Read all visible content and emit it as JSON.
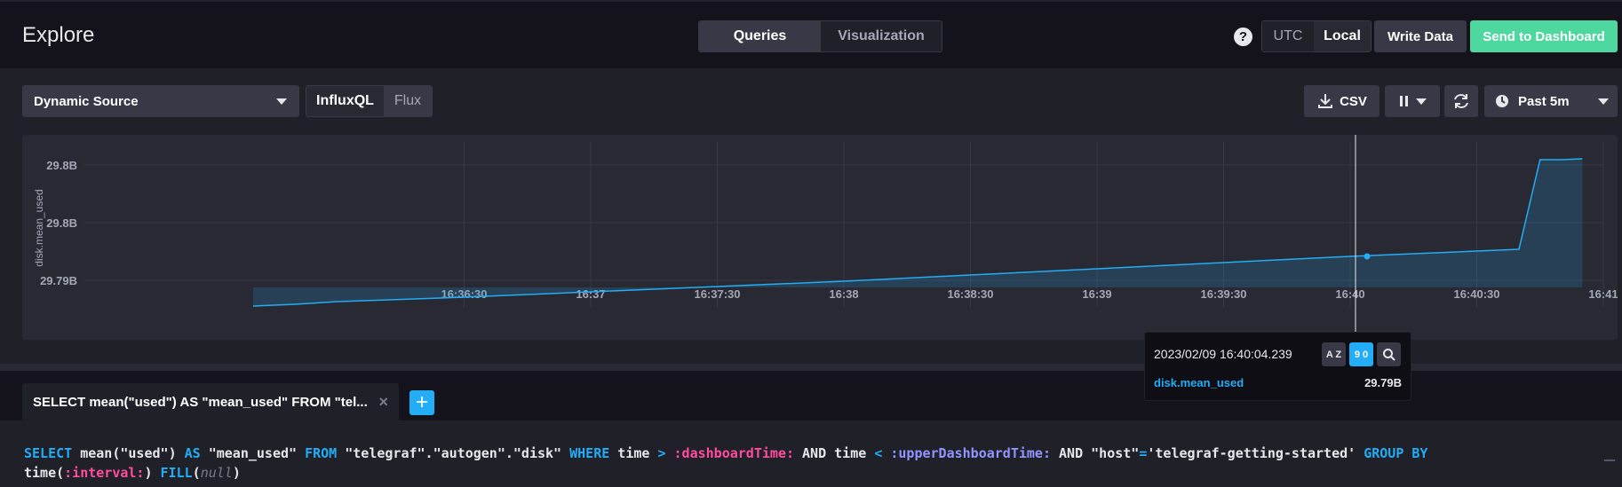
{
  "header": {
    "title": "Explore",
    "mode_tabs": [
      {
        "label": "Queries",
        "active": true
      },
      {
        "label": "Visualization",
        "active": false
      }
    ],
    "help_label": "?",
    "timezone": [
      {
        "label": "UTC",
        "active": false
      },
      {
        "label": "Local",
        "active": true
      }
    ],
    "write_data_label": "Write Data",
    "send_to_dashboard_label": "Send to Dashboard"
  },
  "source": {
    "selected": "Dynamic Source"
  },
  "language": [
    {
      "label": "InfluxQL",
      "active": true
    },
    {
      "label": "Flux",
      "active": false
    }
  ],
  "toolbar": {
    "csv_label": "CSV",
    "time_range": "Past 5m"
  },
  "chart_data": {
    "type": "line",
    "ylabel": "disk.mean_used",
    "ytick_labels": [
      "29.8B",
      "29.8B",
      "29.79B"
    ],
    "xtick_labels": [
      "16:36:30",
      "16:37",
      "16:37:30",
      "16:38",
      "16:38:30",
      "16:39",
      "16:39:30",
      "16:40",
      "16:40:30",
      "16:41"
    ],
    "series": [
      {
        "name": "disk.mean_used",
        "x": [
          "16:35:40",
          "16:35:50",
          "16:36:00",
          "16:36:30",
          "16:37:00",
          "16:37:30",
          "16:38:00",
          "16:38:30",
          "16:39:00",
          "16:39:30",
          "16:40:00",
          "16:40:10",
          "16:40:30",
          "16:40:40",
          "16:40:45",
          "16:40:50",
          "16:40:55"
        ],
        "values": [
          29792.0,
          29792.2,
          29792.5,
          29793.0,
          29793.6,
          29794.2,
          29794.8,
          29795.5,
          29796.2,
          29796.9,
          29797.6,
          29797.8,
          29798.2,
          29798.4,
          29808.5,
          29808.5,
          29808.6
        ]
      }
    ],
    "grid": true,
    "hover": {
      "time": "16:40:04"
    }
  },
  "tooltip": {
    "timestamp": "2023/02/09 16:40:04.239",
    "sort_az_label": "A Z",
    "sort_90_label": "9 0",
    "series": "disk.mean_used",
    "value": "29.79B"
  },
  "query": {
    "tab_label": "SELECT mean(\"used\") AS \"mean_used\" FROM \"tel...",
    "close_label": "×",
    "add_label": "+"
  },
  "colors": {
    "accent": "#22adf6",
    "success": "#4ed8a0",
    "series": "#22adf6"
  }
}
